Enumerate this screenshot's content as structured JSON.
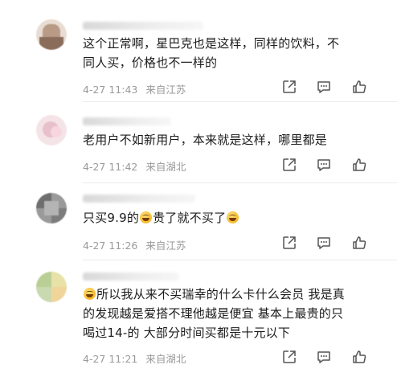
{
  "comments": [
    {
      "text_line1": "这个正常啊，星巴克也是这样，同样的饮料，不",
      "text_line2": "同人买，价格也不一样的",
      "time": "4-27 11:43",
      "location": "来自江苏"
    },
    {
      "text_line1": "老用户不如新用户，本来就是这样，哪里都是",
      "time": "4-27 11:42",
      "location": "来自湖北"
    },
    {
      "text_before": "只买9.9的",
      "text_middle": "贵了就不买了",
      "time": "4-27 11:26",
      "location": "来自江苏"
    },
    {
      "text_line1": "所以我从来不买瑞幸的什么卡什么会员 我是真",
      "text_line2": "的发现越是爱搭不理他越是便宜 基本上最贵的只",
      "text_line3": "喝过14-的 大部分时间买都是十元以下",
      "time": "4-27 11:21",
      "location": "来自湖北"
    }
  ],
  "icons": {
    "share": "share-icon",
    "comment": "comment-icon",
    "like": "like-icon",
    "emoji": "laughing-emoji-icon"
  }
}
